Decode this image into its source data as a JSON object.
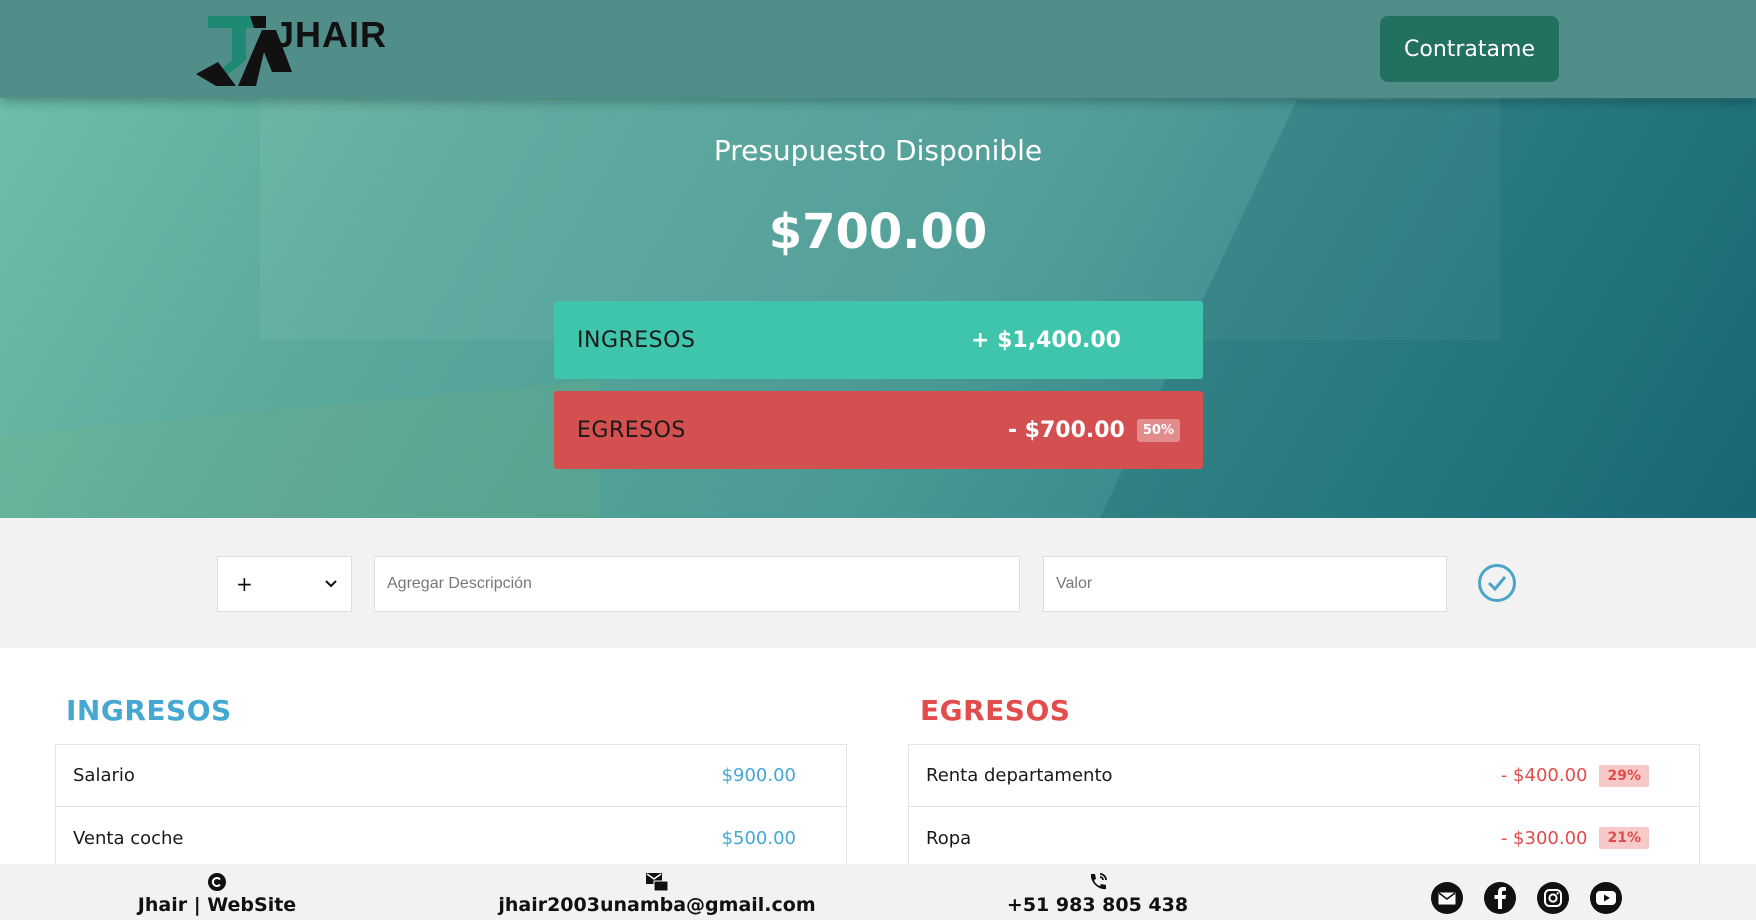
{
  "navbar": {
    "brand": "JHAIR",
    "hire_label": "Contratame"
  },
  "budget": {
    "title": "Presupuesto Disponible",
    "value": "$700.00",
    "income_label": "INGRESOS",
    "income_total": "+ $1,400.00",
    "expense_label": "EGRESOS",
    "expense_total": "- $700.00",
    "expense_pct": "50%"
  },
  "form": {
    "type_value": "+",
    "description_placeholder": "Agregar Descripción",
    "value_placeholder": "Valor"
  },
  "income": {
    "title": "INGRESOS",
    "items": [
      {
        "description": "Salario",
        "value": "$900.00"
      },
      {
        "description": "Venta coche",
        "value": "$500.00"
      }
    ]
  },
  "expenses": {
    "title": "EGRESOS",
    "items": [
      {
        "description": "Renta departamento",
        "value": "- $400.00",
        "pct": "29%"
      },
      {
        "description": "Ropa",
        "value": "- $300.00",
        "pct": "21%"
      }
    ]
  },
  "footer": {
    "copyright": "Jhair | WebSite",
    "email": "jhair2003unamba@gmail.com",
    "phone": "+51 983 805 438"
  },
  "colors": {
    "navbar": "#528e89",
    "hire_button": "#22705f",
    "income_accent": "#3ec5ac",
    "expense_accent": "#d44f50",
    "income_text": "#44a8d3",
    "expense_text": "#e14c4c"
  },
  "icons": [
    "copyright-icon",
    "mail-contact-icon",
    "phone-icon",
    "email-icon",
    "facebook-icon",
    "instagram-icon",
    "youtube-icon",
    "check-circle-icon",
    "chevron-down-icon"
  ]
}
